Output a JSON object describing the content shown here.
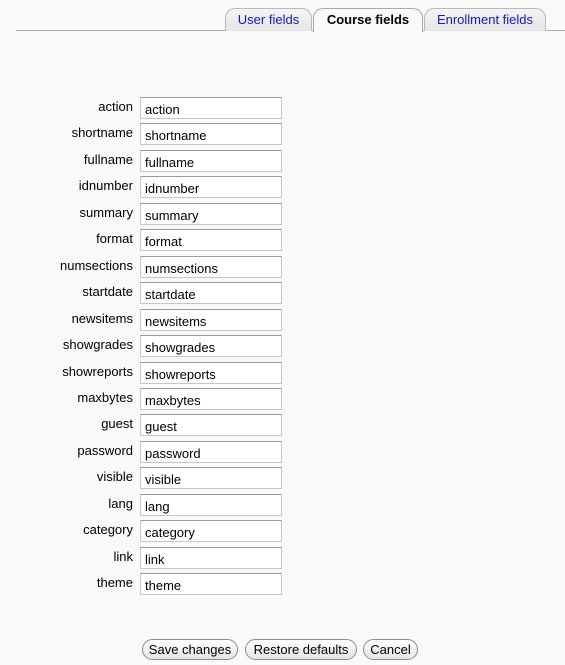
{
  "tabs": [
    {
      "label": "User fields",
      "active": false
    },
    {
      "label": "Course fields",
      "active": true
    },
    {
      "label": "Enrollment fields",
      "active": false
    }
  ],
  "fields": [
    {
      "label": "action",
      "value": "action"
    },
    {
      "label": "shortname",
      "value": "shortname"
    },
    {
      "label": "fullname",
      "value": "fullname"
    },
    {
      "label": "idnumber",
      "value": "idnumber"
    },
    {
      "label": "summary",
      "value": "summary"
    },
    {
      "label": "format",
      "value": "format"
    },
    {
      "label": "numsections",
      "value": "numsections"
    },
    {
      "label": "startdate",
      "value": "startdate"
    },
    {
      "label": "newsitems",
      "value": "newsitems"
    },
    {
      "label": "showgrades",
      "value": "showgrades"
    },
    {
      "label": "showreports",
      "value": "showreports"
    },
    {
      "label": "maxbytes",
      "value": "maxbytes"
    },
    {
      "label": "guest",
      "value": "guest"
    },
    {
      "label": "password",
      "value": "password"
    },
    {
      "label": "visible",
      "value": "visible"
    },
    {
      "label": "lang",
      "value": "lang"
    },
    {
      "label": "category",
      "value": "category"
    },
    {
      "label": "link",
      "value": "link"
    },
    {
      "label": "theme",
      "value": "theme"
    }
  ],
  "buttons": {
    "save": "Save changes",
    "restore": "Restore defaults",
    "cancel": "Cancel"
  }
}
